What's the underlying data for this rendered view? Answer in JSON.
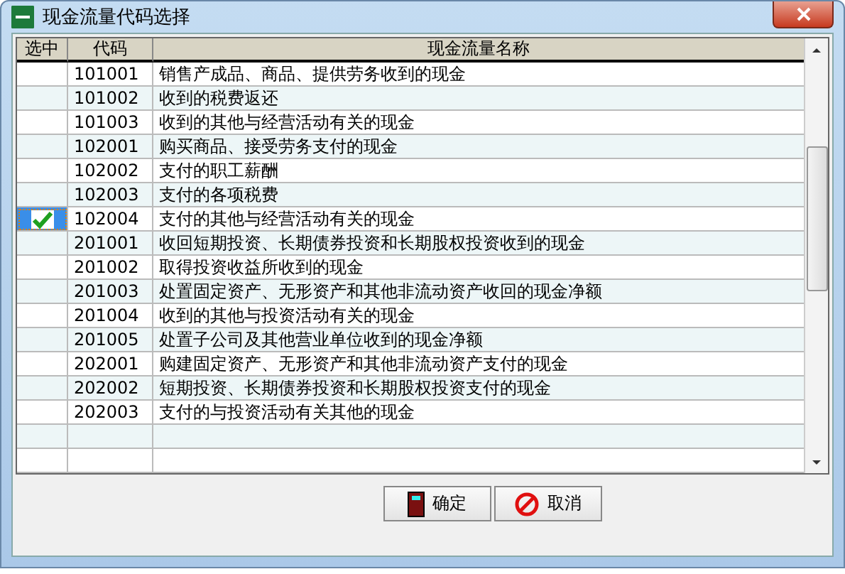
{
  "window": {
    "title": "现金流量代码选择"
  },
  "table": {
    "columns": [
      "选中",
      "代码",
      "现金流量名称"
    ],
    "rows": [
      {
        "selected": false,
        "code": "101001",
        "name": "销售产成品、商品、提供劳务收到的现金"
      },
      {
        "selected": false,
        "code": "101002",
        "name": "收到的税费返还"
      },
      {
        "selected": false,
        "code": "101003",
        "name": "收到的其他与经营活动有关的现金"
      },
      {
        "selected": false,
        "code": "102001",
        "name": "购买商品、接受劳务支付的现金"
      },
      {
        "selected": false,
        "code": "102002",
        "name": "支付的职工薪酬"
      },
      {
        "selected": false,
        "code": "102003",
        "name": "支付的各项税费"
      },
      {
        "selected": true,
        "code": "102004",
        "name": "支付的其他与经营活动有关的现金"
      },
      {
        "selected": false,
        "code": "201001",
        "name": "收回短期投资、长期债券投资和长期股权投资收到的现金"
      },
      {
        "selected": false,
        "code": "201002",
        "name": "取得投资收益所收到的现金"
      },
      {
        "selected": false,
        "code": "201003",
        "name": "处置固定资产、无形资产和其他非流动资产收回的现金净额"
      },
      {
        "selected": false,
        "code": "201004",
        "name": "收到的其他与投资活动有关的现金"
      },
      {
        "selected": false,
        "code": "201005",
        "name": "处置子公司及其他营业单位收到的现金净额"
      },
      {
        "selected": false,
        "code": "202001",
        "name": "购建固定资产、无形资产和其他非流动资产支付的现金"
      },
      {
        "selected": false,
        "code": "202002",
        "name": "短期投资、长期债券投资和长期股权投资支付的现金"
      },
      {
        "selected": false,
        "code": "202003",
        "name": "支付的与投资活动有关其他的现金"
      }
    ]
  },
  "buttons": [
    {
      "kind": "ok",
      "label": "确定"
    },
    {
      "kind": "cancel",
      "label": "取消"
    }
  ]
}
